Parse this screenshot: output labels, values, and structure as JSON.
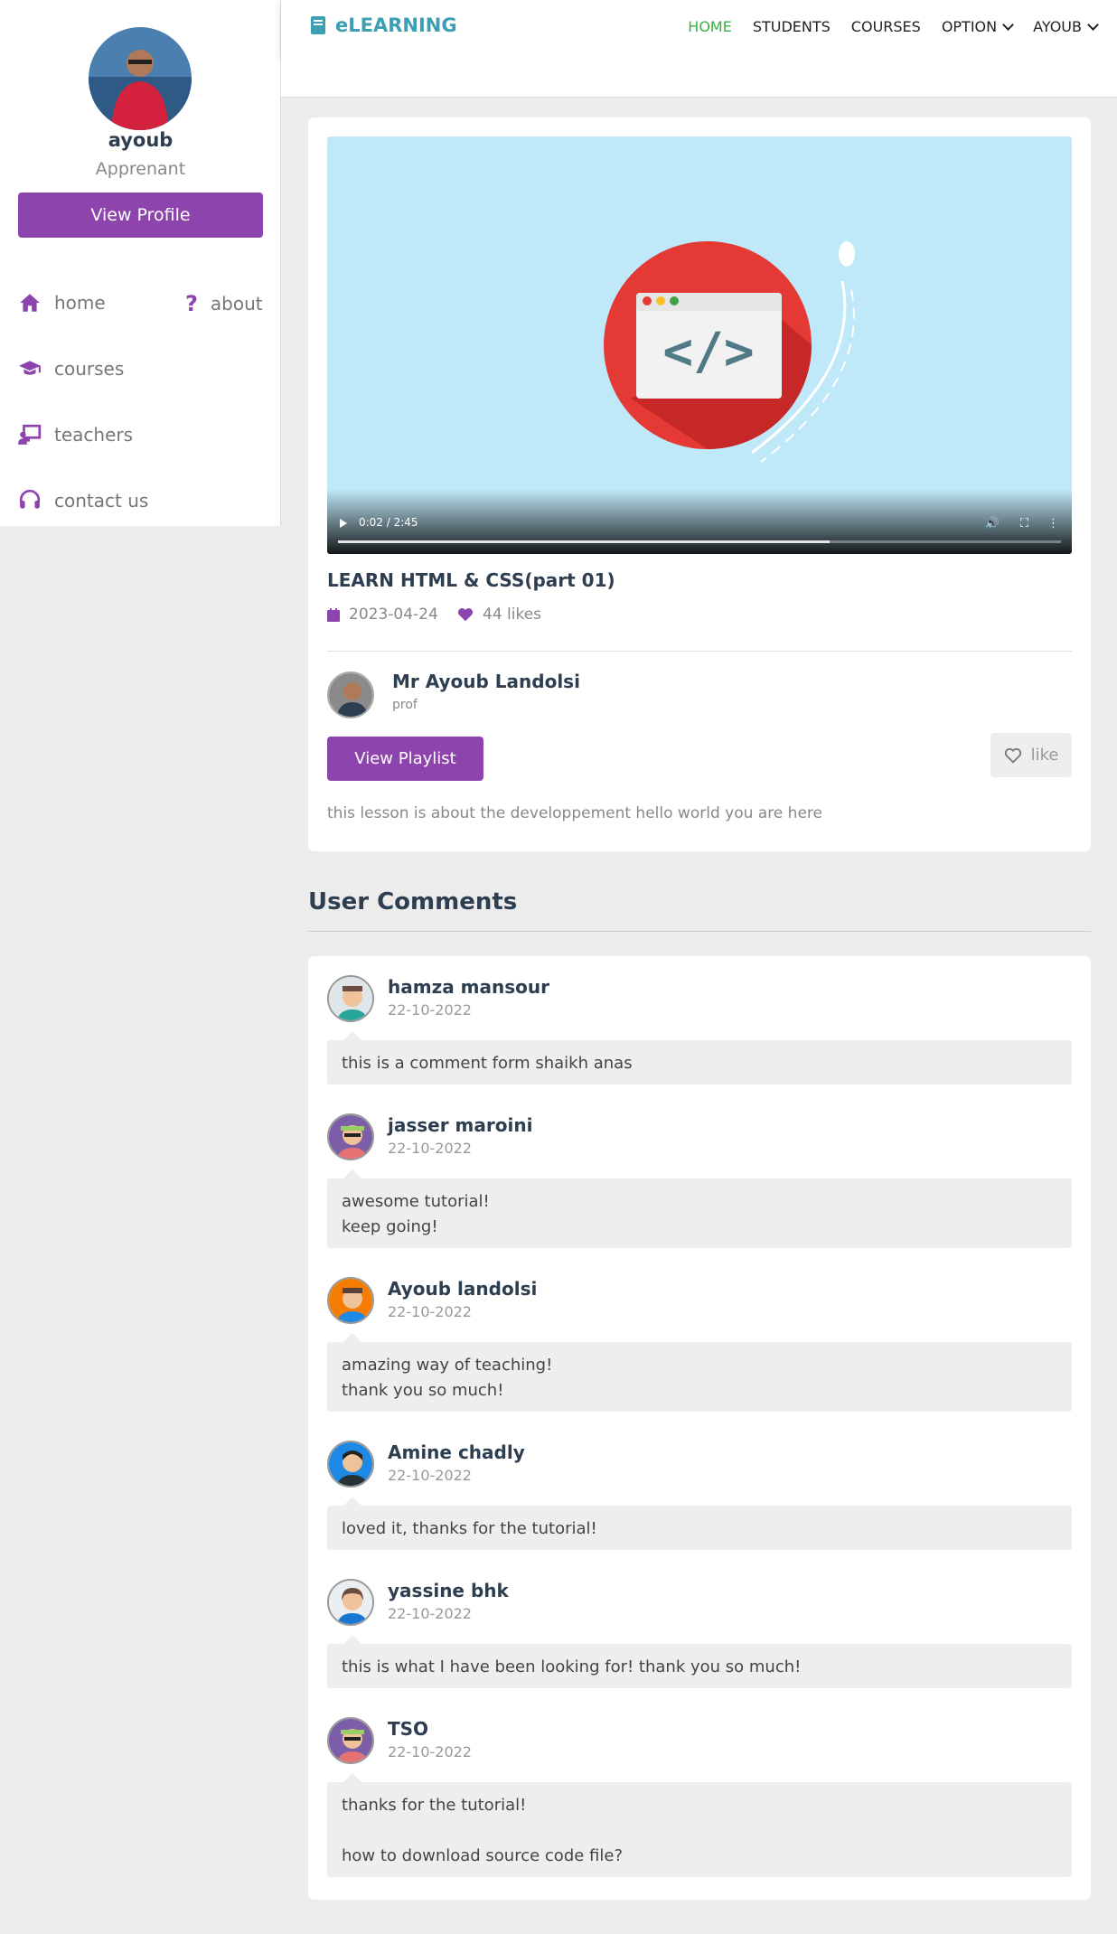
{
  "sidebar": {
    "profile_name": "ayoub",
    "profile_role": "Apprenant",
    "view_profile_label": "View Profile",
    "nav": {
      "home": "home",
      "about": "about",
      "courses": "courses",
      "teachers": "teachers",
      "contact": "contact us"
    }
  },
  "header": {
    "brand": "eLEARNING",
    "menu": [
      "HOME",
      "STUDENTS",
      "COURSES",
      "OPTION",
      "AYOUB"
    ]
  },
  "video": {
    "time": "0:02 / 2:45",
    "progress_fraction": 0.68,
    "title": "LEARN HTML & CSS(part 01)",
    "date": "2023-04-24",
    "likes": "44 likes",
    "tutor_name": "Mr Ayoub Landolsi",
    "tutor_role": "prof",
    "playlist_label": "View Playlist",
    "like_label": "like",
    "description": "this lesson is about the developpement hello world you are here"
  },
  "comments_title": "User Comments",
  "comments": [
    {
      "name": "hamza mansour",
      "date": "22-10-2022",
      "text": "this is a comment form shaikh anas"
    },
    {
      "name": "jasser maroini",
      "date": "22-10-2022",
      "text": "awesome tutorial!\nkeep going!"
    },
    {
      "name": "Ayoub landolsi",
      "date": "22-10-2022",
      "text": "amazing way of teaching!\nthank you so much!"
    },
    {
      "name": "Amine chadly",
      "date": "22-10-2022",
      "text": "loved it, thanks for the tutorial!"
    },
    {
      "name": "yassine bhk",
      "date": "22-10-2022",
      "text": "this is what I have been looking for! thank you so much!"
    },
    {
      "name": "TSO",
      "date": "22-10-2022",
      "text": "thanks for the tutorial!\n\nhow to download source code file?"
    }
  ],
  "colors": {
    "accent": "#8e44ad",
    "brand": "#3c9fb3",
    "active_nav": "#3cb043"
  }
}
